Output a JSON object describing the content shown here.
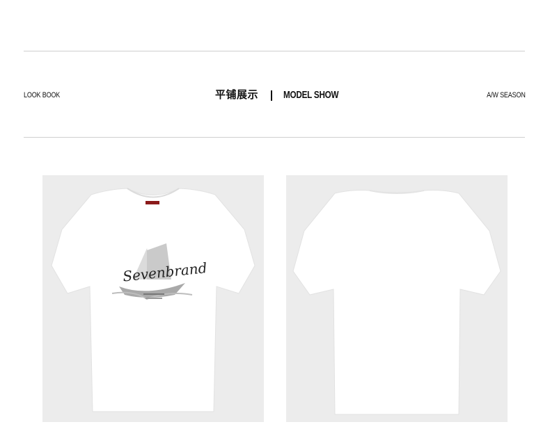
{
  "header": {
    "left_label": "LOOK BOOK",
    "center_cn": "平铺展示",
    "center_en": "MODEL SHOW",
    "right_label": "A/W SEASON"
  },
  "products": [
    {
      "view": "front",
      "print_text": "Sevenbrand"
    },
    {
      "view": "back"
    }
  ],
  "colors": {
    "background": "#ffffff",
    "card": "#ececec",
    "shirt": "#ffffff",
    "rule": "#cfcfcf"
  }
}
